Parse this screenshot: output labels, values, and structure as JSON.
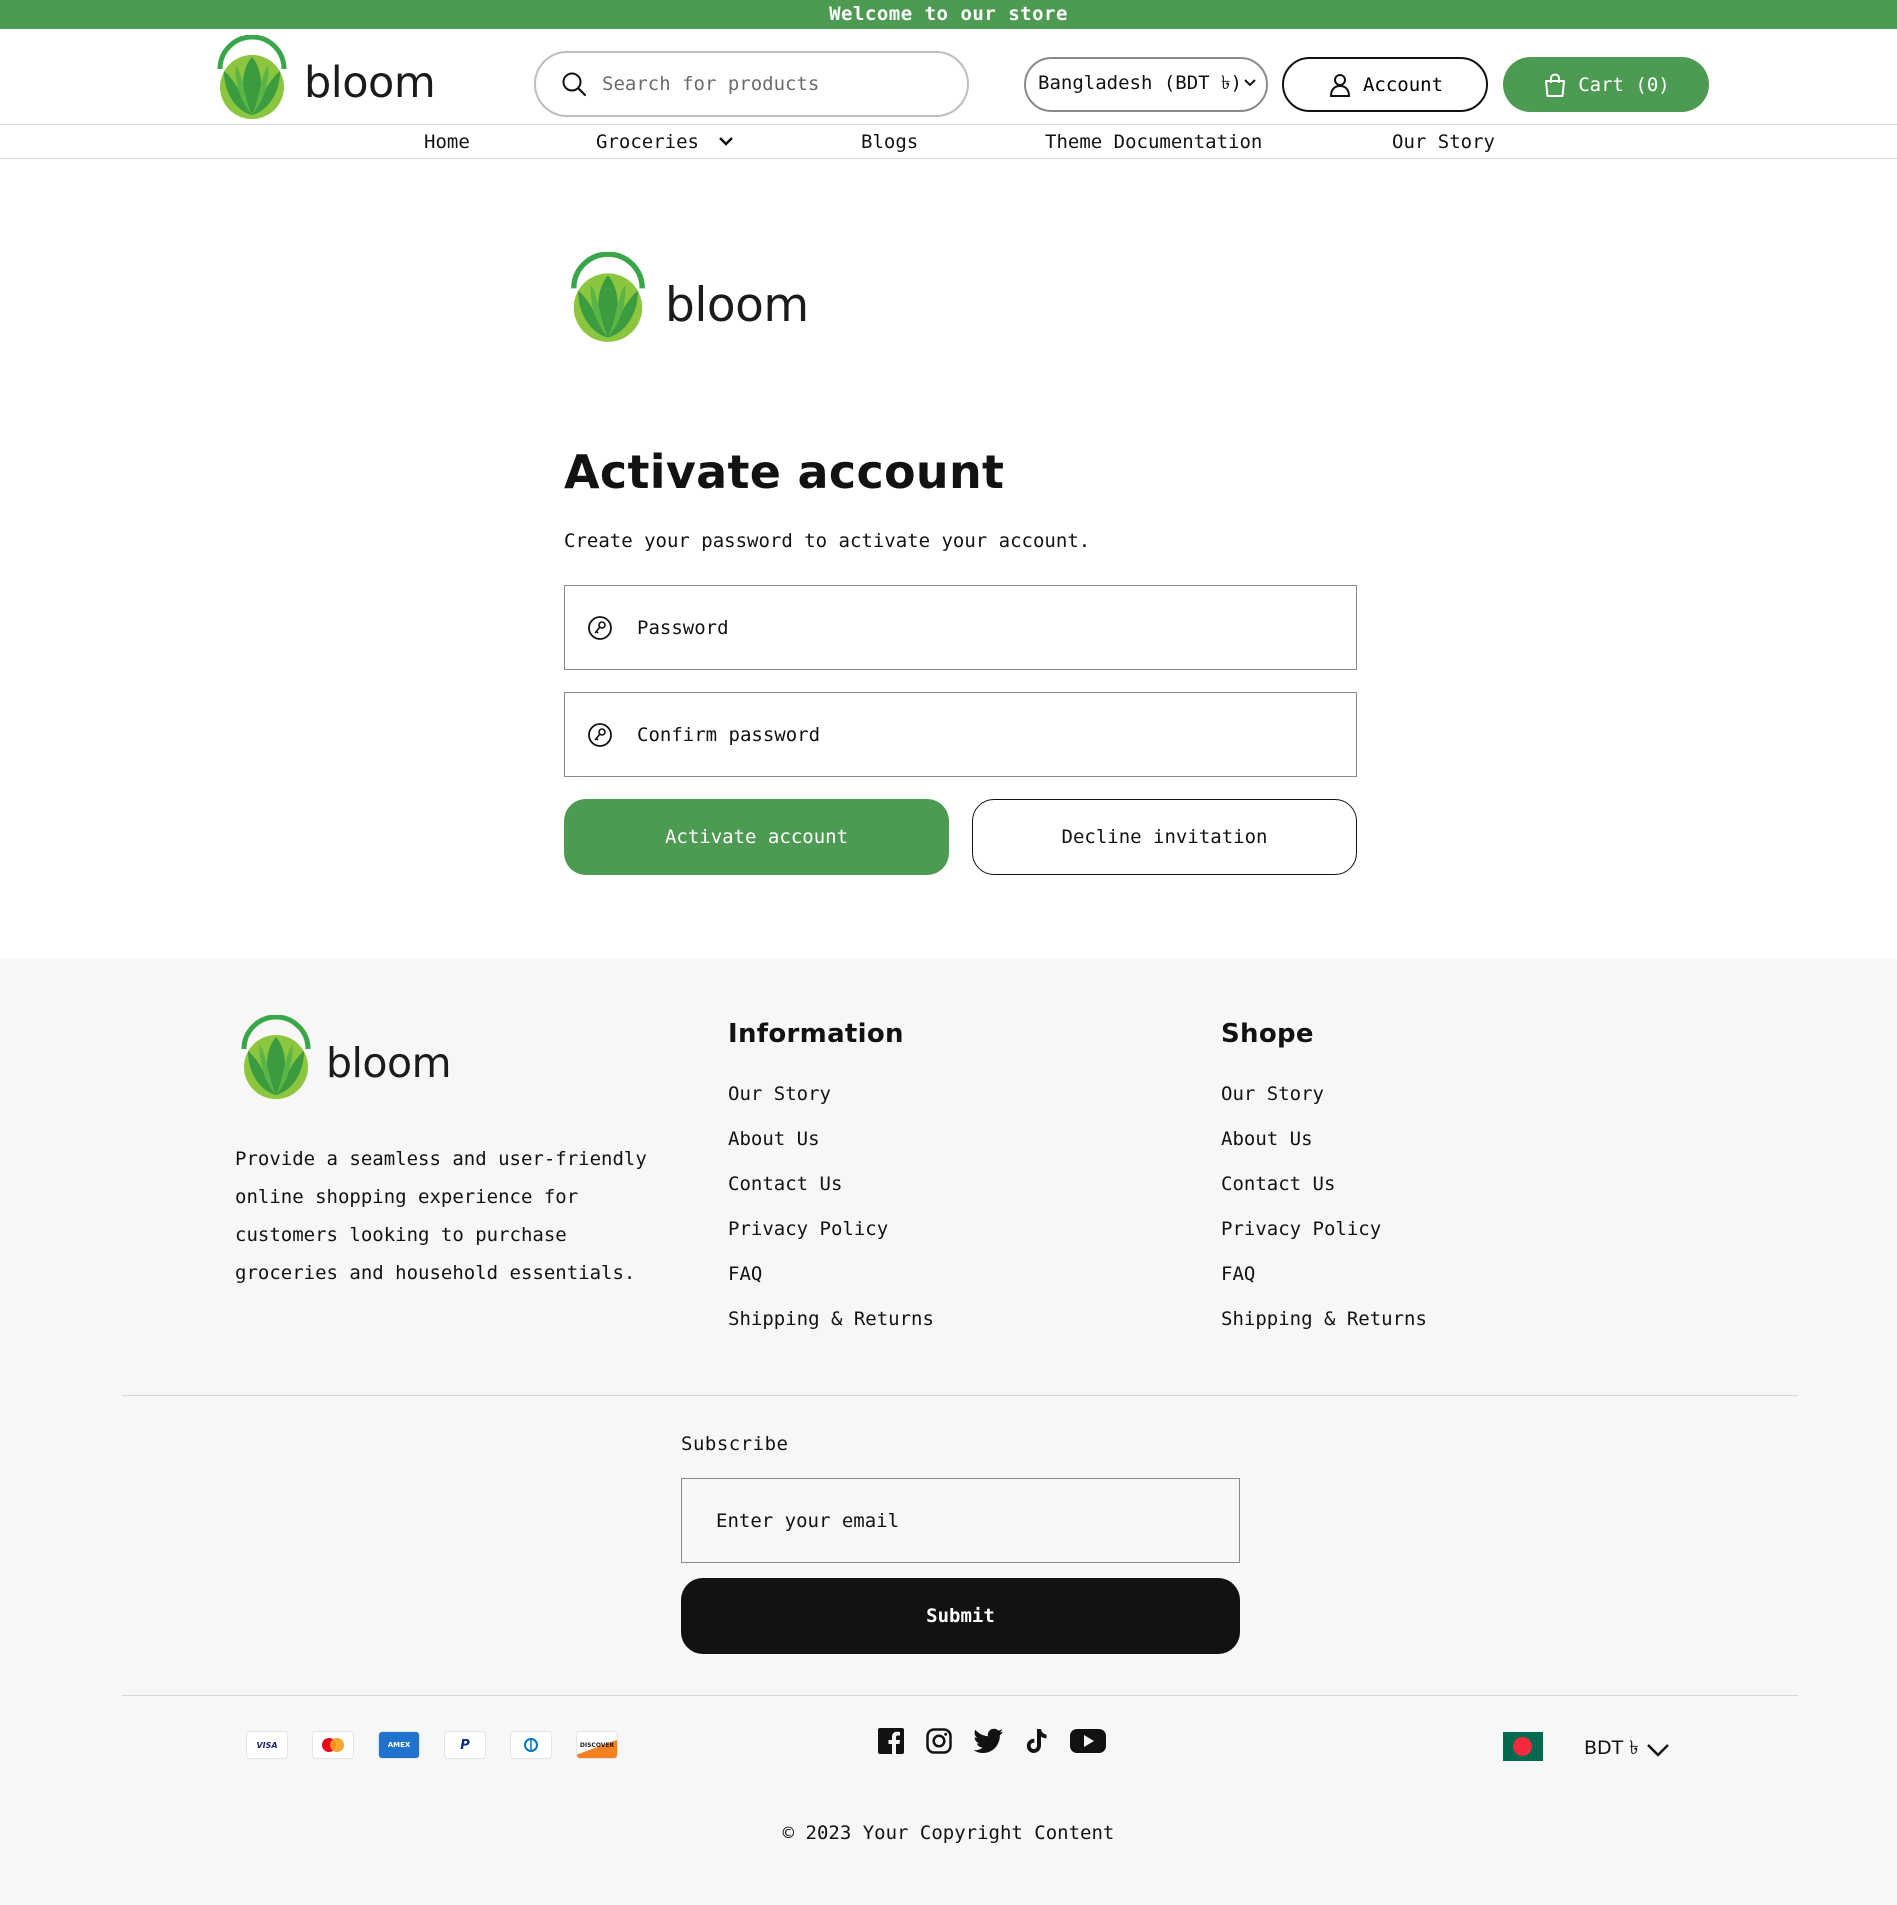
{
  "announcement": "Welcome to our store",
  "brand": {
    "name": "bloom",
    "color_green": "#4d9a52",
    "logo_green_light": "#8cc63f",
    "logo_green_dark": "#3a9b3f"
  },
  "header": {
    "search_placeholder": "Search for products",
    "country_label": "Bangladesh (BDT ৳)",
    "account_label": "Account",
    "cart_label": "Cart (0)"
  },
  "nav": {
    "items": [
      {
        "label": "Home"
      },
      {
        "label": "Groceries",
        "icon": "chevron-down-icon"
      },
      {
        "label": "Blogs"
      },
      {
        "label": "Theme Documentation"
      },
      {
        "label": "Our Story"
      }
    ]
  },
  "main": {
    "title": "Activate account",
    "subtitle": "Create your password to activate your account.",
    "password_placeholder": "Password",
    "confirm_placeholder": "Confirm password",
    "activate_label": "Activate account",
    "decline_label": "Decline invitation"
  },
  "footer": {
    "description": "Provide a seamless and user-friendly online shopping experience for customers looking to purchase groceries and household essentials.",
    "columns": [
      {
        "title": "Information",
        "links": [
          "Our Story",
          "About Us",
          "Contact Us",
          "Privacy Policy",
          "FAQ",
          "Shipping & Returns"
        ]
      },
      {
        "title": "Shope",
        "links": [
          "Our Story",
          "About Us",
          "Contact Us",
          "Privacy Policy",
          "FAQ",
          "Shipping & Returns"
        ]
      }
    ],
    "subscribe_label": "Subscribe",
    "email_placeholder": "Enter your email",
    "submit_label": "Submit",
    "payment_methods": [
      "VISA",
      "",
      "AMEX",
      "",
      "",
      "DISCOVER"
    ],
    "payment_icons": [
      "visa-icon",
      "mastercard-icon",
      "amex-icon",
      "paypal-icon",
      "diners-club-icon",
      "discover-icon"
    ],
    "social_icons": [
      "facebook-icon",
      "instagram-icon",
      "twitter-icon",
      "tiktok-icon",
      "youtube-icon"
    ],
    "currency_label": "BDT ৳",
    "copyright": "© 2023 Your Copyright Content"
  }
}
